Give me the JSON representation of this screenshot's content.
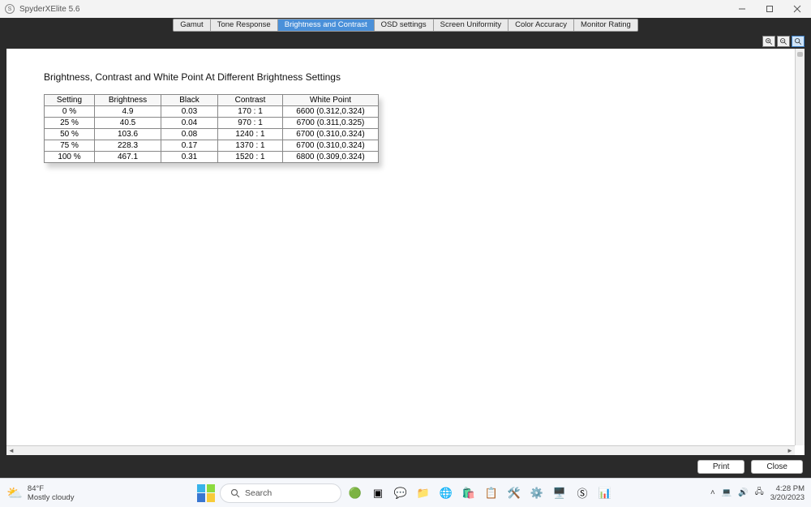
{
  "window": {
    "title": "SpyderXElite 5.6"
  },
  "tabs": [
    {
      "label": "Gamut",
      "selected": false
    },
    {
      "label": "Tone Response",
      "selected": false
    },
    {
      "label": "Brightness and Contrast",
      "selected": true
    },
    {
      "label": "OSD settings",
      "selected": false
    },
    {
      "label": "Screen Uniformity",
      "selected": false
    },
    {
      "label": "Color Accuracy",
      "selected": false
    },
    {
      "label": "Monitor Rating",
      "selected": false
    }
  ],
  "page": {
    "heading": "Brightness, Contrast and White Point At Different Brightness Settings",
    "columns": [
      "Setting",
      "Brightness",
      "Black",
      "Contrast",
      "White Point"
    ],
    "rows": [
      {
        "setting": "0 %",
        "brightness": "4.9",
        "black": "0.03",
        "contrast": "170 : 1",
        "wp": "6600 (0.312,0.324)"
      },
      {
        "setting": "25 %",
        "brightness": "40.5",
        "black": "0.04",
        "contrast": "970 : 1",
        "wp": "6700 (0.311,0.325)"
      },
      {
        "setting": "50 %",
        "brightness": "103.6",
        "black": "0.08",
        "contrast": "1240 : 1",
        "wp": "6700 (0.310,0.324)"
      },
      {
        "setting": "75 %",
        "brightness": "228.3",
        "black": "0.17",
        "contrast": "1370 : 1",
        "wp": "6700 (0.310,0.324)"
      },
      {
        "setting": "100 %",
        "brightness": "467.1",
        "black": "0.31",
        "contrast": "1520 : 1",
        "wp": "6800 (0.309,0.324)"
      }
    ]
  },
  "buttons": {
    "print": "Print",
    "close": "Close"
  },
  "taskbar": {
    "weather_temp": "84°F",
    "weather_desc": "Mostly cloudy",
    "search_placeholder": "Search",
    "time": "4:28 PM",
    "date": "3/20/2023"
  },
  "chart_data": {
    "type": "table",
    "title": "Brightness, Contrast and White Point At Different Brightness Settings",
    "columns": [
      "Setting",
      "Brightness",
      "Black",
      "Contrast",
      "White Point"
    ],
    "rows": [
      [
        "0 %",
        4.9,
        0.03,
        "170 : 1",
        "6600 (0.312,0.324)"
      ],
      [
        "25 %",
        40.5,
        0.04,
        "970 : 1",
        "6700 (0.311,0.325)"
      ],
      [
        "50 %",
        103.6,
        0.08,
        "1240 : 1",
        "6700 (0.310,0.324)"
      ],
      [
        "75 %",
        228.3,
        0.17,
        "1370 : 1",
        "6700 (0.310,0.324)"
      ],
      [
        "100 %",
        467.1,
        0.31,
        "1520 : 1",
        "6800 (0.309,0.324)"
      ]
    ]
  }
}
